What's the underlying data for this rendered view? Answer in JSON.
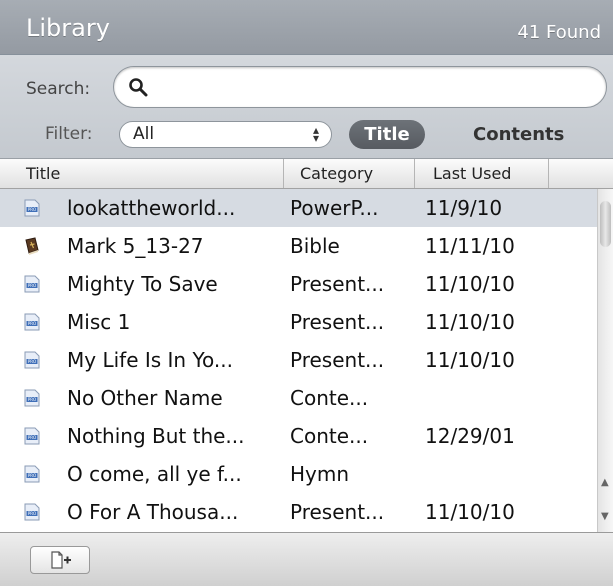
{
  "header": {
    "title": "Library",
    "count": "41 Found"
  },
  "search": {
    "label": "Search:",
    "value": "",
    "placeholder": ""
  },
  "filter": {
    "label": "Filter:",
    "selected": "All",
    "toggle_title": "Title",
    "toggle_contents": "Contents",
    "active": "Title"
  },
  "columns": {
    "title": "Title",
    "category": "Category",
    "last_used": "Last Used"
  },
  "rows": [
    {
      "title": "lookattheworld...",
      "category": "PowerP...",
      "last_used": "11/9/10",
      "icon": "presentation-icon",
      "selected": true
    },
    {
      "title": "Mark 5_13-27",
      "category": "Bible",
      "last_used": "11/11/10",
      "icon": "bible-icon"
    },
    {
      "title": "Mighty To Save",
      "category": "Present...",
      "last_used": "11/10/10",
      "icon": "presentation-icon"
    },
    {
      "title": "Misc 1",
      "category": "Present...",
      "last_used": "11/10/10",
      "icon": "presentation-icon"
    },
    {
      "title": "My Life Is In Yo...",
      "category": "Present...",
      "last_used": "11/10/10",
      "icon": "presentation-icon"
    },
    {
      "title": "No Other Name",
      "category": "Conte...",
      "last_used": "",
      "icon": "presentation-icon"
    },
    {
      "title": "Nothing But the...",
      "category": "Conte...",
      "last_used": "12/29/01",
      "icon": "presentation-icon"
    },
    {
      "title": "O come, all ye f...",
      "category": "Hymn",
      "last_used": "",
      "icon": "presentation-icon"
    },
    {
      "title": "O For A Thousa...",
      "category": "Present...",
      "last_used": "11/10/10",
      "icon": "presentation-icon"
    }
  ],
  "footer": {
    "add_icon": "new-document-icon"
  },
  "colors": {
    "header_bg": "#9ea4ab",
    "selected_row": "#d6dbe2",
    "toggle_active": "#61666c"
  }
}
